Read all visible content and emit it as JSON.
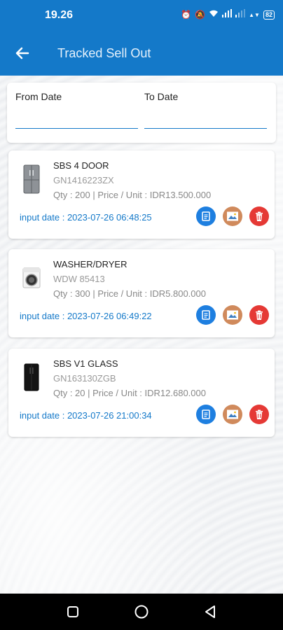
{
  "status_bar": {
    "time": "19.26",
    "battery": "82"
  },
  "app_bar": {
    "title": "Tracked Sell Out"
  },
  "filter": {
    "from_label": "From Date",
    "to_label": "To Date",
    "from_value": "",
    "to_value": ""
  },
  "items": [
    {
      "name": "SBS 4 DOOR",
      "code": "GN1416223ZX",
      "meta": "Qty : 200 | Price / Unit : IDR13.500.000",
      "input_date": "input date : 2023-07-26 06:48:25",
      "thumb": "fridge-4door"
    },
    {
      "name": "WASHER/DRYER",
      "code": "WDW 85413",
      "meta": "Qty : 300 | Price / Unit : IDR5.800.000",
      "input_date": "input date : 2023-07-26 06:49:22",
      "thumb": "washer"
    },
    {
      "name": "SBS V1 GLASS",
      "code": "GN163130ZGB",
      "meta": "Qty : 20 | Price / Unit : IDR12.680.000",
      "input_date": "input date : 2023-07-26 21:00:34",
      "thumb": "fridge-glass"
    }
  ],
  "colors": {
    "primary": "#1479c9",
    "doc": "#1e7fe0",
    "image": "#d08a5c",
    "delete": "#e53935"
  }
}
